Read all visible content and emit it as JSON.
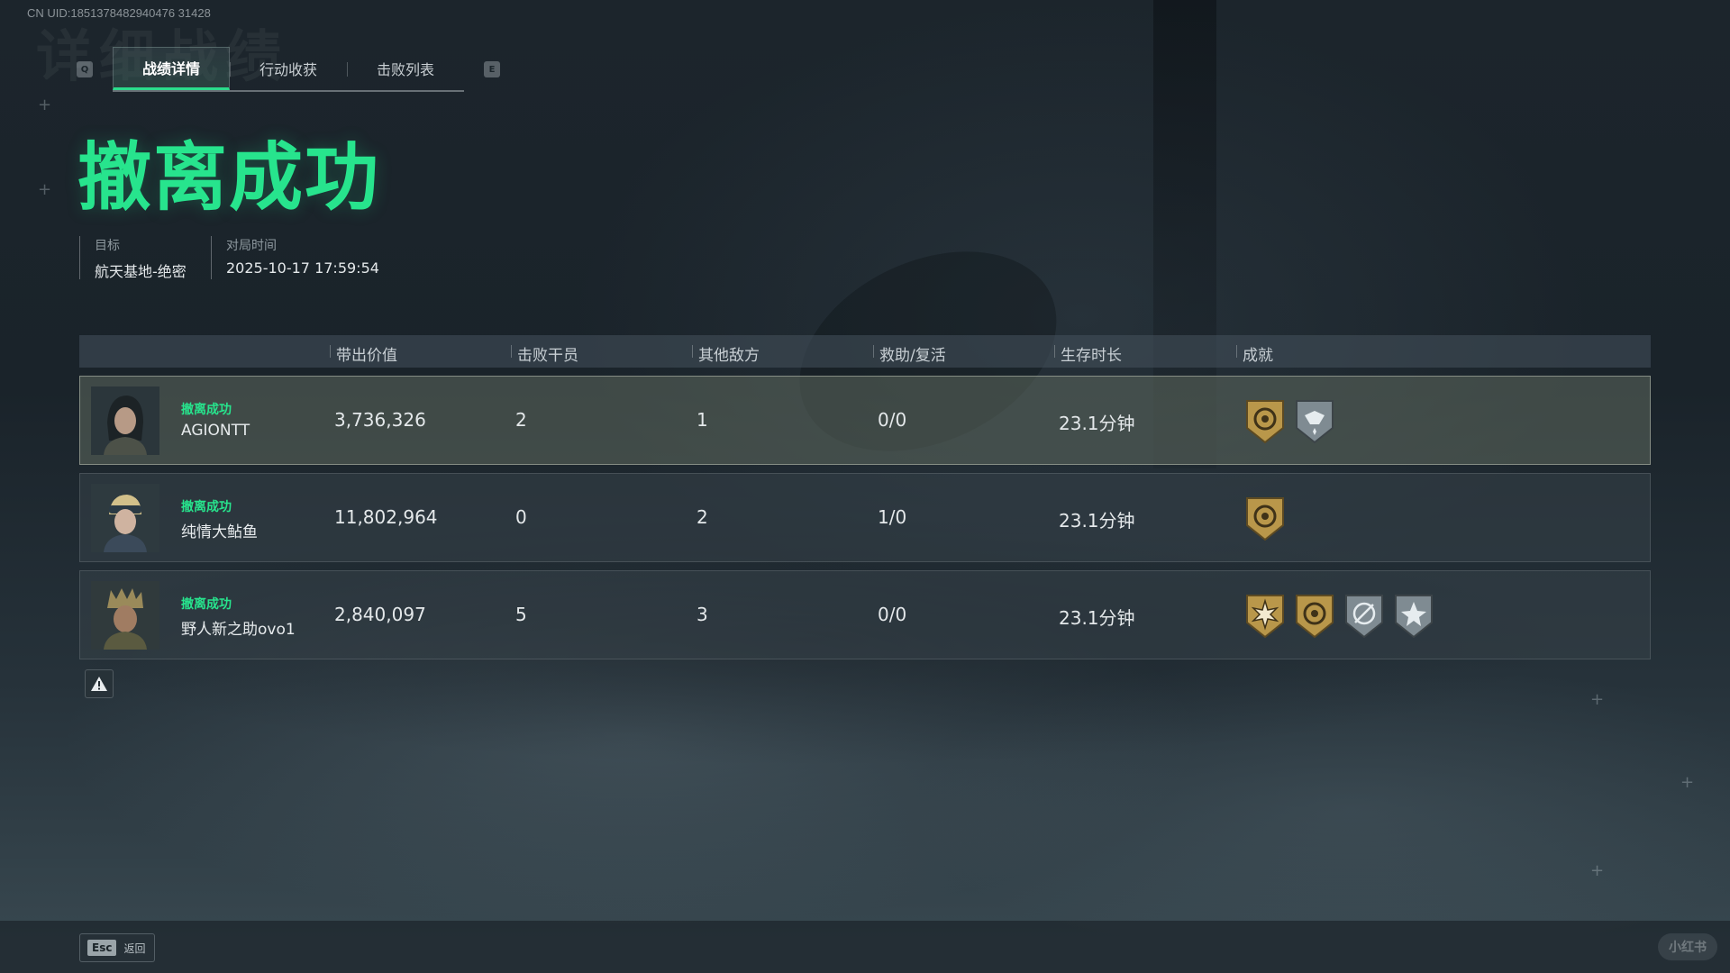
{
  "uid": "CN UID:1851378482940476 31428",
  "tabs": {
    "prev_key": "Q",
    "next_key": "E",
    "items": [
      {
        "label": "战绩详情"
      },
      {
        "label": "行动收获"
      },
      {
        "label": "击败列表"
      }
    ]
  },
  "result_title": "撤离成功",
  "meta": {
    "target_label": "目标",
    "target_value": "航天基地-绝密",
    "time_label": "对局时间",
    "time_value": "2025-10-17 17:59:54"
  },
  "table": {
    "headers": [
      "带出价值",
      "击败干员",
      "其他敌方",
      "救助/复活",
      "生存时长",
      "成就"
    ],
    "rows": [
      {
        "status": "撤离成功",
        "name": "AGIONTT",
        "value": "3,736,326",
        "kills": "2",
        "other_enemies": "1",
        "assist_revive": "0/0",
        "survival": "23.1分钟",
        "badges": [
          "gold-compass-badge",
          "silver-handshake-badge"
        ]
      },
      {
        "status": "撤离成功",
        "name": "纯情大鲇鱼",
        "value": "11,802,964",
        "kills": "0",
        "other_enemies": "2",
        "assist_revive": "1/0",
        "survival": "23.1分钟",
        "badges": [
          "gold-compass-badge"
        ]
      },
      {
        "status": "撤离成功",
        "name": "野人新之助ovo1",
        "value": "2,840,097",
        "kills": "5",
        "other_enemies": "3",
        "assist_revive": "0/0",
        "survival": "23.1分钟",
        "badges": [
          "gold-star-burst-badge",
          "gold-compass-badge",
          "silver-target-badge",
          "silver-star-badge"
        ]
      }
    ]
  },
  "footer": {
    "esc_key": "Esc",
    "back_label": "返回",
    "watermark": "小红书"
  },
  "colors": {
    "accent_green": "#27e48d",
    "gold_badge": "#b9974a",
    "silver_badge": "#7f8b92"
  }
}
